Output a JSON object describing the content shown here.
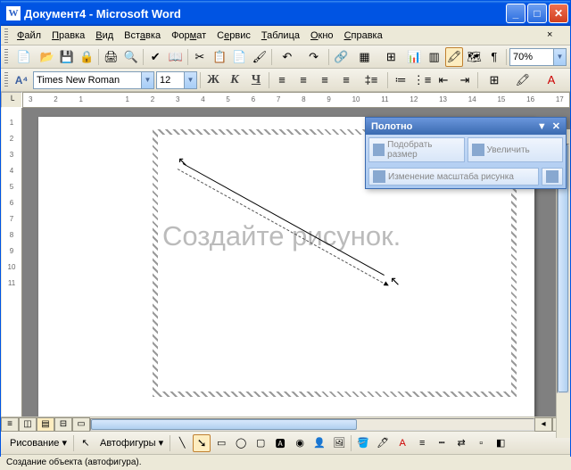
{
  "window": {
    "title": "Документ4 - Microsoft Word"
  },
  "menu": {
    "file": "Файл",
    "edit": "Правка",
    "view": "Вид",
    "insert": "Вставка",
    "format": "Формат",
    "tools": "Сервис",
    "table": "Таблица",
    "window": "Окно",
    "help": "Справка"
  },
  "toolbar": {
    "zoom": "70%"
  },
  "fonttb": {
    "font": "Times New Roman",
    "size": "12"
  },
  "ruler": {
    "ticks": [
      "3",
      "2",
      "1",
      "",
      "1",
      "2",
      "3",
      "4",
      "5",
      "6",
      "7",
      "8",
      "9",
      "10",
      "11",
      "12",
      "13",
      "14",
      "15",
      "16",
      "17"
    ]
  },
  "canvas": {
    "placeholder": "Создайте рисунок."
  },
  "floating_toolbar": {
    "title": "Полотно",
    "fit": "Подобрать размер",
    "expand": "Увеличить",
    "scale": "Изменение масштаба рисунка"
  },
  "draw_toolbar": {
    "draw": "Рисование",
    "autoshapes": "Автофигуры"
  },
  "status": {
    "text": "Создание объекта (автофигура)."
  }
}
